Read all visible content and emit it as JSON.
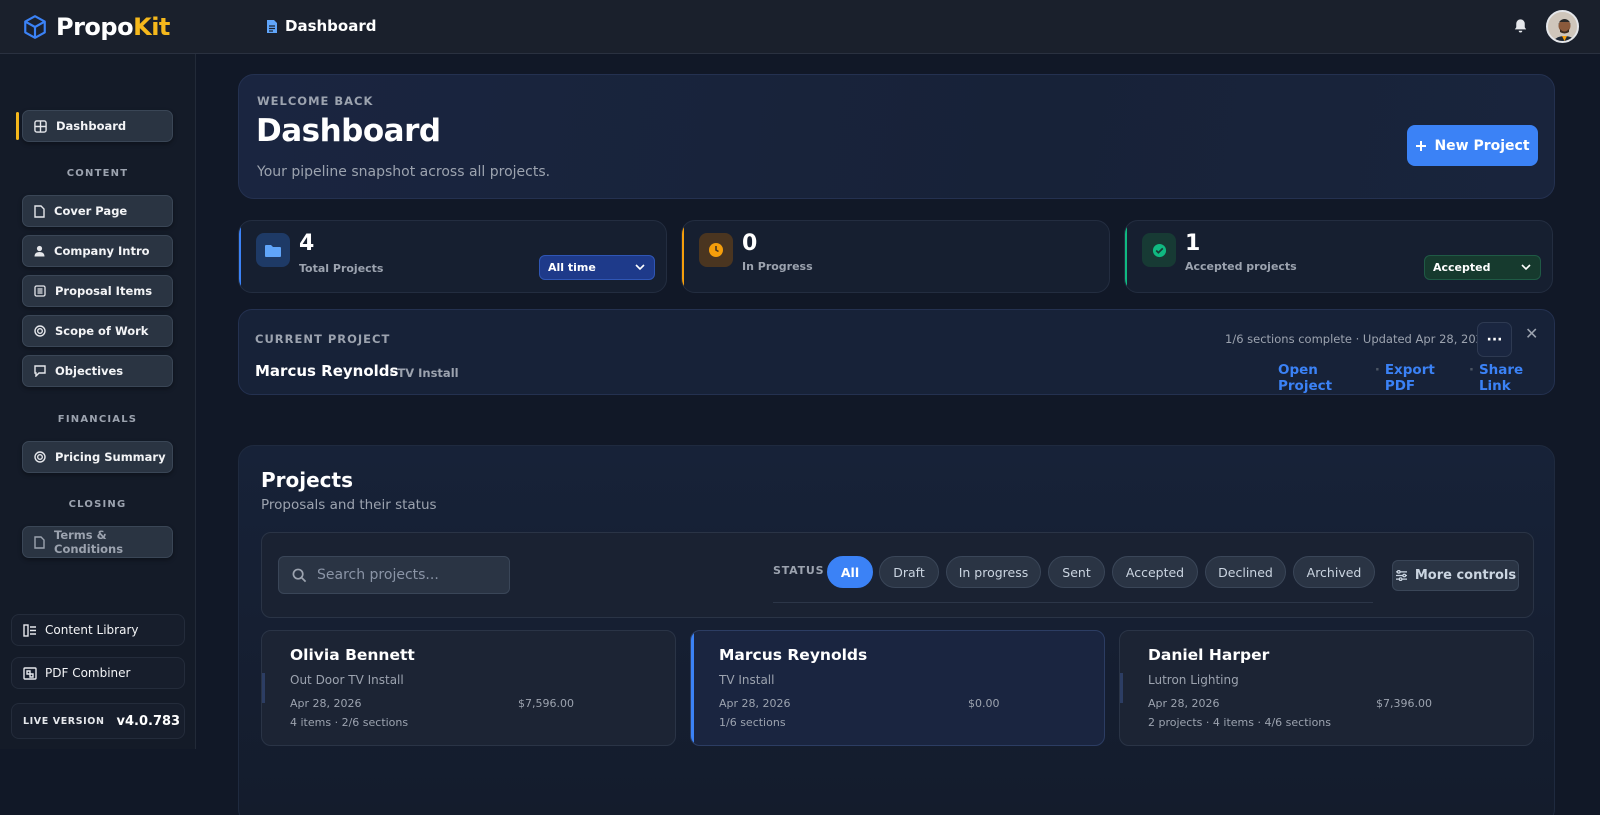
{
  "app": {
    "logo_part1": "Propo",
    "logo_part2": "Kit",
    "breadcrumb": "Dashboard"
  },
  "sidebar": {
    "dashboard": "Dashboard",
    "sections": [
      {
        "label": "CONTENT",
        "items": [
          "Cover Page",
          "Company Intro",
          "Proposal Items",
          "Scope of Work",
          "Objectives"
        ]
      },
      {
        "label": "FINANCIALS",
        "items": [
          "Pricing Summary"
        ]
      },
      {
        "label": "CLOSING",
        "items": [
          "Terms & Conditions"
        ]
      }
    ],
    "links": [
      "Content Library",
      "PDF Combiner"
    ],
    "version_label": "LIVE VERSION",
    "version": "v4.0.783"
  },
  "hero": {
    "welcome": "WELCOME BACK",
    "title": "Dashboard",
    "subtitle": "Your pipeline snapshot across all projects.",
    "new_project": "New Project"
  },
  "stats": [
    {
      "value": "4",
      "label": "Total Projects",
      "select": "All time",
      "color": "#3b82f6"
    },
    {
      "value": "0",
      "label": "In Progress",
      "color": "#f59e0b"
    },
    {
      "value": "1",
      "label": "Accepted projects",
      "select": "Accepted",
      "color": "#10b981"
    }
  ],
  "current": {
    "label": "CURRENT PROJECT",
    "name": "Marcus Reynolds",
    "type": "· TV Install",
    "meta": "1/6 sections complete  ·  Updated Apr 28, 2026",
    "more": "···",
    "close": "✕",
    "actions": [
      "Open Project",
      "Export PDF",
      "Share Link"
    ],
    "sep": "·"
  },
  "projects": {
    "title": "Projects",
    "subtitle": "Proposals and their status",
    "search_placeholder": "Search projects...",
    "status_label": "STATUS",
    "chips": [
      "All",
      "Draft",
      "In progress",
      "Sent",
      "Accepted",
      "Declined",
      "Archived"
    ],
    "more_controls": "More controls",
    "cards": [
      {
        "name": "Olivia Bennett",
        "type": "Out Door TV Install",
        "date": "Apr 28, 2026",
        "price": "$7,596.00",
        "meta": "4 items · 2/6 sections"
      },
      {
        "name": "Marcus Reynolds",
        "type": "TV Install",
        "date": "Apr 28, 2026",
        "price": "$0.00",
        "meta": "1/6 sections"
      },
      {
        "name": "Daniel Harper",
        "type": "Lutron Lighting",
        "date": "Apr 28, 2026",
        "price": "$7,396.00",
        "meta": "2 projects · 4 items · 4/6 sections"
      }
    ]
  },
  "colors": {
    "accent": "#3b82f6",
    "brand_yellow": "#f5b81c",
    "background": "#111827"
  }
}
